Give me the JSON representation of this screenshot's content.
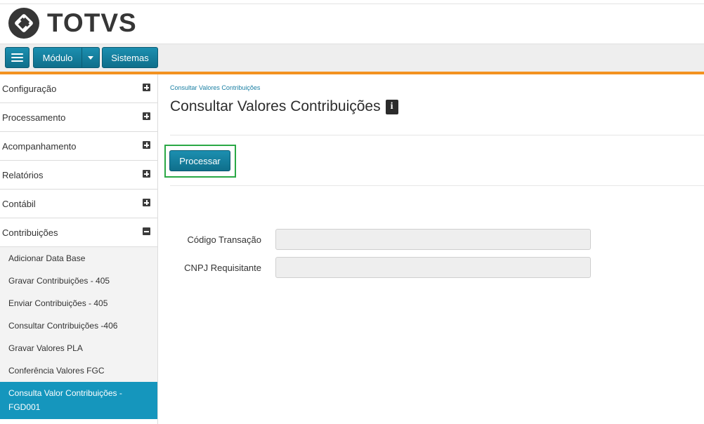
{
  "brand": {
    "name": "TOTVS"
  },
  "colors": {
    "accent": "#f39220",
    "primary": "#1596bd",
    "highlight": "#2aa845"
  },
  "navbar": {
    "modulo_label": "Módulo",
    "sistemas_label": "Sistemas"
  },
  "sidebar": {
    "items": [
      {
        "label": "Configuração",
        "state": "collapsed"
      },
      {
        "label": "Processamento",
        "state": "collapsed"
      },
      {
        "label": "Acompanhamento",
        "state": "collapsed"
      },
      {
        "label": "Relatórios",
        "state": "collapsed"
      },
      {
        "label": "Contábil",
        "state": "collapsed"
      },
      {
        "label": "Contribuições",
        "state": "expanded"
      }
    ],
    "sub_items": [
      {
        "label": "Adicionar Data Base"
      },
      {
        "label": "Gravar Contribuições - 405"
      },
      {
        "label": "Enviar Contribuições - 405"
      },
      {
        "label": "Consultar Contribuições -406"
      },
      {
        "label": "Gravar Valores PLA"
      },
      {
        "label": "Conferência Valores FGC"
      },
      {
        "label": "Consulta Valor Contribuições - FGD001",
        "active": true
      }
    ]
  },
  "main": {
    "breadcrumb": "Consultar Valores Contribuições",
    "title": "Consultar Valores Contribuições",
    "info_icon": "info-icon",
    "process_button": "Processar",
    "fields": [
      {
        "label": "Código Transação",
        "value": ""
      },
      {
        "label": "CNPJ Requisitante",
        "value": ""
      }
    ]
  }
}
